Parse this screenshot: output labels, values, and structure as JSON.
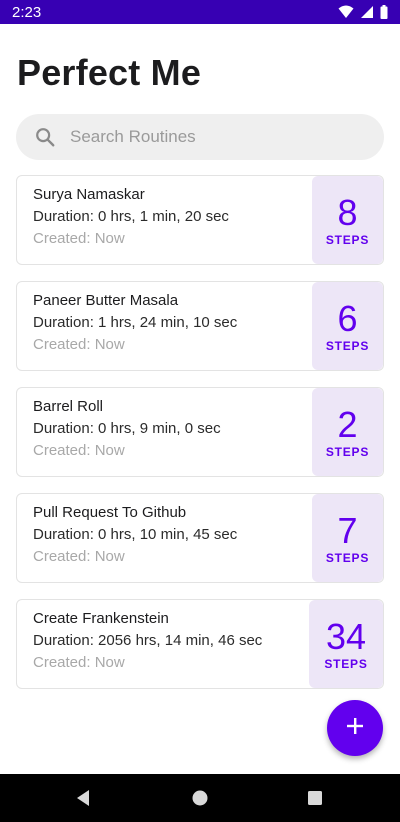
{
  "status_bar": {
    "time": "2:23",
    "background": "#3700b3",
    "icons": [
      "wifi-icon",
      "signal-icon",
      "battery-icon"
    ]
  },
  "page": {
    "title": "Perfect Me"
  },
  "search": {
    "placeholder": "Search Routines",
    "value": "",
    "icon": "search-icon"
  },
  "routines": [
    {
      "name": "Surya Namaskar",
      "duration": "Duration: 0 hrs, 1 min, 20 sec",
      "created": "Created: Now",
      "steps": "8",
      "steps_label": "STEPS"
    },
    {
      "name": "Paneer Butter Masala",
      "duration": "Duration: 1 hrs, 24 min, 10 sec",
      "created": "Created: Now",
      "steps": "6",
      "steps_label": "STEPS"
    },
    {
      "name": "Barrel Roll",
      "duration": "Duration: 0 hrs, 9 min, 0 sec",
      "created": "Created: Now",
      "steps": "2",
      "steps_label": "STEPS"
    },
    {
      "name": "Pull Request To Github",
      "duration": "Duration: 0 hrs, 10 min, 45 sec",
      "created": "Created: Now",
      "steps": "7",
      "steps_label": "STEPS"
    },
    {
      "name": "Create Frankenstein",
      "duration": "Duration: 2056 hrs, 14 min, 46 sec",
      "created": "Created: Now",
      "steps": "34",
      "steps_label": "STEPS"
    }
  ],
  "fab": {
    "icon": "plus-icon"
  },
  "nav_bar": {
    "buttons": [
      "back-icon",
      "home-icon",
      "recents-icon"
    ]
  },
  "colors": {
    "accent": "#6200ee",
    "steps_background": "#ede6f7",
    "search_background": "#efefef"
  }
}
